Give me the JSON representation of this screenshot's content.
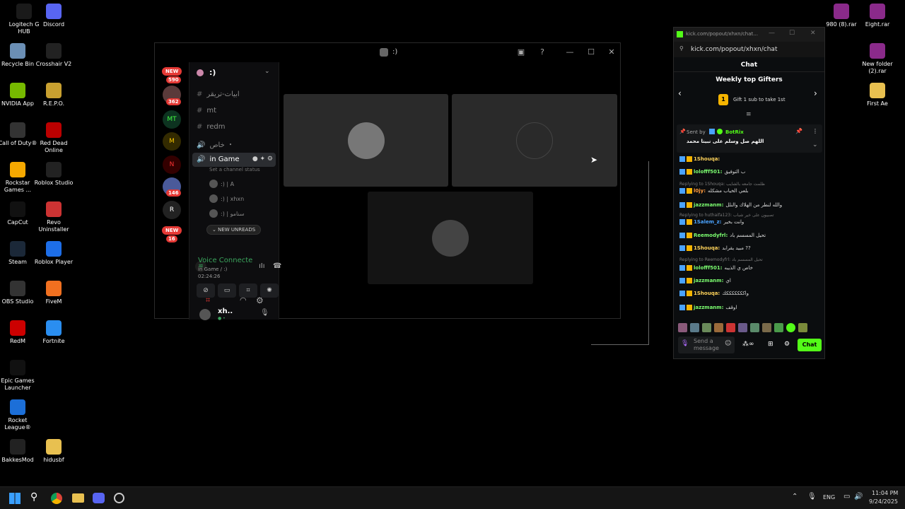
{
  "desktop": {
    "left_icons": [
      {
        "label": "Logitech G HUB",
        "icon": "logitech-icon",
        "color": "#1a1a1a"
      },
      {
        "label": "Discord",
        "icon": "discord-icon",
        "color": "#5865f2"
      },
      {
        "label": "Recycle Bin",
        "icon": "recycle-bin-icon",
        "color": "#6b8fb5"
      },
      {
        "label": "Crosshair V2",
        "icon": "crosshair-icon",
        "color": "#222"
      },
      {
        "label": "NVIDIA App",
        "icon": "nvidia-icon",
        "color": "#76b900"
      },
      {
        "label": "R.E.P.O.",
        "icon": "repo-icon",
        "color": "#c8a030"
      },
      {
        "label": "Call of Duty®",
        "icon": "cod-icon",
        "color": "#333"
      },
      {
        "label": "Red Dead Online",
        "icon": "rdo-icon",
        "color": "#b00"
      },
      {
        "label": "Rockstar Games ...",
        "icon": "rockstar-icon",
        "color": "#f5a800"
      },
      {
        "label": "Roblox Studio",
        "icon": "roblox-studio-icon",
        "color": "#222"
      },
      {
        "label": "CapCut",
        "icon": "capcut-icon",
        "color": "#111"
      },
      {
        "label": "Revo Uninstaller",
        "icon": "revo-icon",
        "color": "#c33"
      },
      {
        "label": "Steam",
        "icon": "steam-icon",
        "color": "#1b2838"
      },
      {
        "label": "Roblox Player",
        "icon": "roblox-icon",
        "color": "#1d6ee8"
      },
      {
        "label": "OBS Studio",
        "icon": "obs-icon",
        "color": "#333"
      },
      {
        "label": "FiveM",
        "icon": "fivem-icon",
        "color": "#f07020"
      },
      {
        "label": "RedM",
        "icon": "redm-icon",
        "color": "#c00"
      },
      {
        "label": "Fortnite",
        "icon": "fortnite-icon",
        "color": "#2a8ef0"
      },
      {
        "label": "Epic Games Launcher",
        "icon": "epic-icon",
        "color": "#111"
      },
      {
        "label": "Rocket League®",
        "icon": "rocket-league-icon",
        "color": "#1c6fd8"
      },
      {
        "label": "BakkesMod",
        "icon": "bakkesmod-icon",
        "color": "#222"
      },
      {
        "label": "hidusbf",
        "icon": "folder-icon",
        "color": "#e8c050"
      }
    ],
    "right_icons": [
      {
        "label": "980 (8).rar",
        "icon": "winrar-icon",
        "color": "#8a2a8a"
      },
      {
        "label": "Eight.rar",
        "icon": "winrar-icon",
        "color": "#8a2a8a"
      },
      {
        "label": "New folder (2).rar",
        "icon": "winrar-icon",
        "color": "#8a2a8a"
      },
      {
        "label": "First Ae",
        "icon": "folder-icon",
        "color": "#e8c050"
      }
    ]
  },
  "discord": {
    "title": ":)",
    "server_name": ":)",
    "new_label": "NEW",
    "badge_590": "590",
    "badge_362": "362",
    "badge_146": "146",
    "badge_bottom": "16",
    "channels": [
      {
        "name": "ابيات-تريقر"
      },
      {
        "name": "mt"
      },
      {
        "name": "redm"
      },
      {
        "name": "خاص ・"
      }
    ],
    "voice_channel": "in Game",
    "channel_status": "Set a channel status",
    "voice_users": [
      ":) | A",
      ":) | xhxn",
      ":) | سنامو"
    ],
    "new_unreads": "NEW UNREADS",
    "voice_connected": "Voice Connecte",
    "voice_location": "in Game / :)",
    "voice_time": "02:24:26",
    "username": "xh..",
    "user_sub": "● •"
  },
  "kick": {
    "tab_title": "kick.com/popout/xhxn/chat...",
    "url": "kick.com/popout/xhxn/chat",
    "header": "Chat",
    "gifters_title": "Weekly top Gifters",
    "gift_rank": "1",
    "gift_text": "Gift 1 sub to take 1st",
    "sent_by": "Sent by",
    "botname": "BotRix",
    "pinned_msg": "اللهم صل وسلم على نبينا محمد",
    "messages": [
      {
        "user": "1Shouqa:",
        "text": "",
        "color": "#ffd35a"
      },
      {
        "user": "lolofff501:",
        "text": "ب التوفيق",
        "color": "#7cff70"
      },
      {
        "reply": "Replying to 1Shouqa: ظلمت جامعه بالشايب"
      },
      {
        "user": "l0jy:",
        "text": "بلعي الخياب مشكله",
        "color": "#ff9a3c"
      },
      {
        "user": "jazzmanm:",
        "text": "والله لنطر من الهلاك والنلل",
        "color": "#7cff70"
      },
      {
        "reply": "Replying to huthaifa123: تصبيون على خير شباب"
      },
      {
        "user": "1Salem_z:",
        "text": "وانت بخير",
        "color": "#4aa3ff"
      },
      {
        "user": "Reemodyfrl:",
        "text": "تحيل المسسم باد",
        "color": "#7cff70"
      },
      {
        "user": "1Shouqa:",
        "text": "مبيد يقرابد ??",
        "color": "#ffd35a"
      },
      {
        "reply": "Replying to Reemodyfrl: تحيل المسسم باد"
      },
      {
        "user": "lolofff501:",
        "text": "خاص ي الذيبه",
        "color": "#7cff70"
      },
      {
        "user": "jazzmanm:",
        "text": "اي",
        "color": "#7cff70"
      },
      {
        "user": "1Shouqa:",
        "text": "واكككككككك",
        "color": "#ffd35a"
      },
      {
        "user": "jazzmanm:",
        "text": "اوقف",
        "color": "#7cff70"
      }
    ],
    "input_placeholder": "Send a message",
    "chat_button": "Chat",
    "accent": "#53fc18"
  },
  "taskbar": {
    "lang": "ENG",
    "time": "11:04 PM",
    "date": "9/24/2025"
  }
}
